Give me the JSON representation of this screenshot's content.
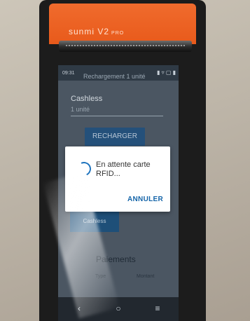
{
  "device": {
    "brand": "sunmi V2",
    "model_suffix": "PRO"
  },
  "status": {
    "time": "09:31",
    "icons": "▮ ▿ ▢ ▮"
  },
  "app": {
    "title": "Rechargement 1 unité"
  },
  "cashless": {
    "label": "Cashless",
    "input_value": "1 unité"
  },
  "buttons": {
    "recharger": "RECHARGER",
    "cashless": "Cashless"
  },
  "paiements": {
    "title": "Paiements",
    "col_type": "Type",
    "col_montant": "Montant"
  },
  "dialog": {
    "message": "En attente carte RFID...",
    "cancel": "ANNULER"
  },
  "navbar": {
    "back": "‹",
    "home": "○",
    "menu": "≡"
  }
}
